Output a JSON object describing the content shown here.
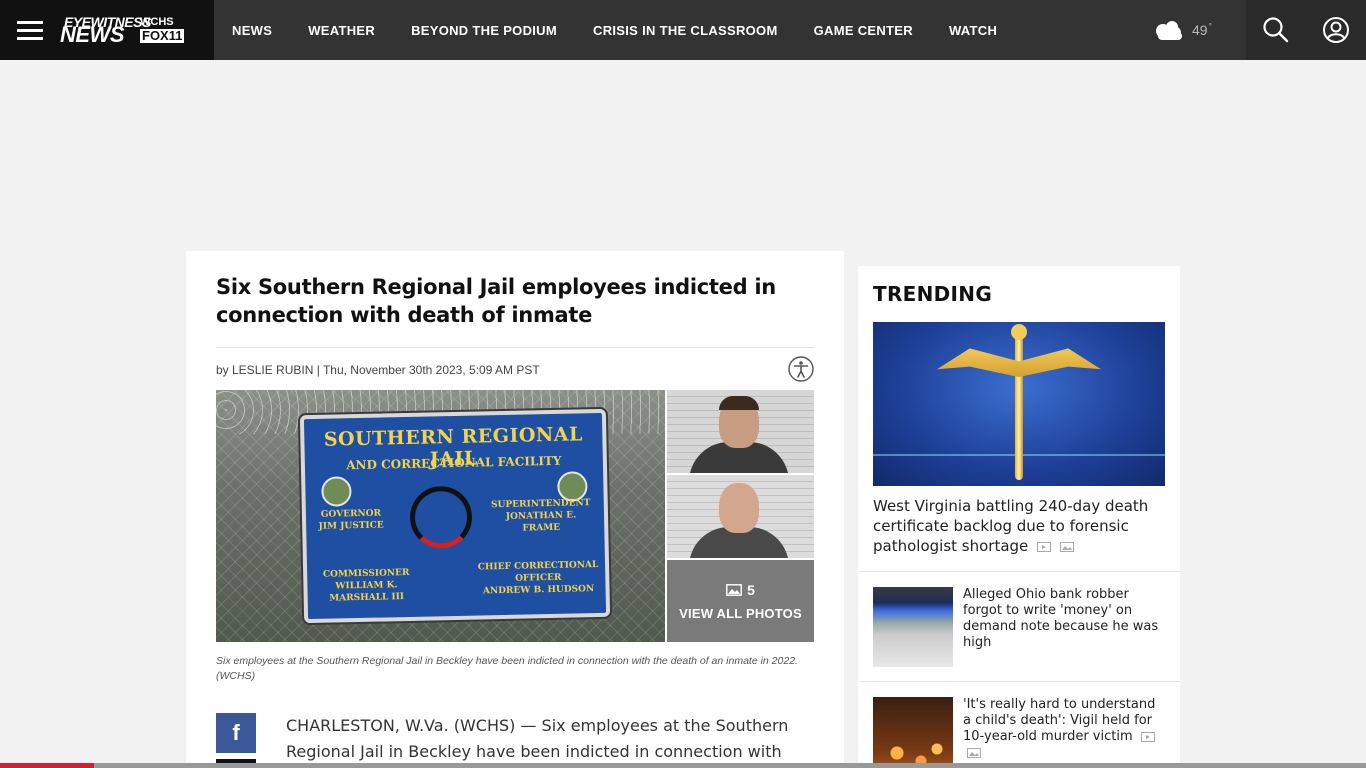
{
  "header": {
    "logo_line1": "EYEWITNESS",
    "logo_line2": "NEWS",
    "logo_wchs": "WCHS",
    "logo_fox": "FOX11",
    "nav": [
      "NEWS",
      "WEATHER",
      "BEYOND THE PODIUM",
      "CRISIS IN THE CLASSROOM",
      "GAME CENTER",
      "WATCH"
    ],
    "temperature": "49",
    "temp_unit": "°",
    "icons": {
      "menu": "hamburger-icon",
      "weather": "cloudy-icon",
      "search": "search-icon",
      "account": "user-icon"
    }
  },
  "article": {
    "headline": "Six Southern Regional Jail employees indicted in connection with death of inmate",
    "byline": "by LESLIE RUBIN | Thu, November 30th 2023, 5:09 AM PST",
    "photo": {
      "sign_line1": "SOUTHERN REGIONAL JAIL",
      "sign_line2": "AND CORRECTIONAL FACILITY",
      "governor": "GOVERNOR\nJIM JUSTICE",
      "superintendent": "SUPERINTENDENT\nJONATHAN E. FRAME",
      "commissioner": "COMMISSIONER\nWILLIAM K. MARSHALL III",
      "chief": "CHIEF CORRECTIONAL OFFICER\nANDREW B. HUDSON"
    },
    "photo_count": "5",
    "view_all_label": "VIEW ALL PHOTOS",
    "caption": "Six employees at the Southern Regional Jail in Beckley have been indicted in connection with the death of an inmate in 2022. (WCHS)",
    "body": "CHARLESTON, W.Va. (WCHS) — Six employees at the Southern Regional Jail in Beckley have been indicted in connection with the",
    "facebook_glyph": "f"
  },
  "trending": {
    "title": "TRENDING",
    "lead": "West Virginia battling 240-day death certificate backlog due to forensic pathologist shortage",
    "items": [
      {
        "title": "Alleged Ohio bank robber forgot to write 'money' on demand note because he was high"
      },
      {
        "title": "'It's really hard to understand a child's death': Vigil held for 10-year-old murder victim"
      }
    ]
  },
  "progress": {
    "fraction": 0.069
  },
  "colors": {
    "topbar": "#333333",
    "accent": "#d31e33",
    "facebook": "#3b5998"
  }
}
